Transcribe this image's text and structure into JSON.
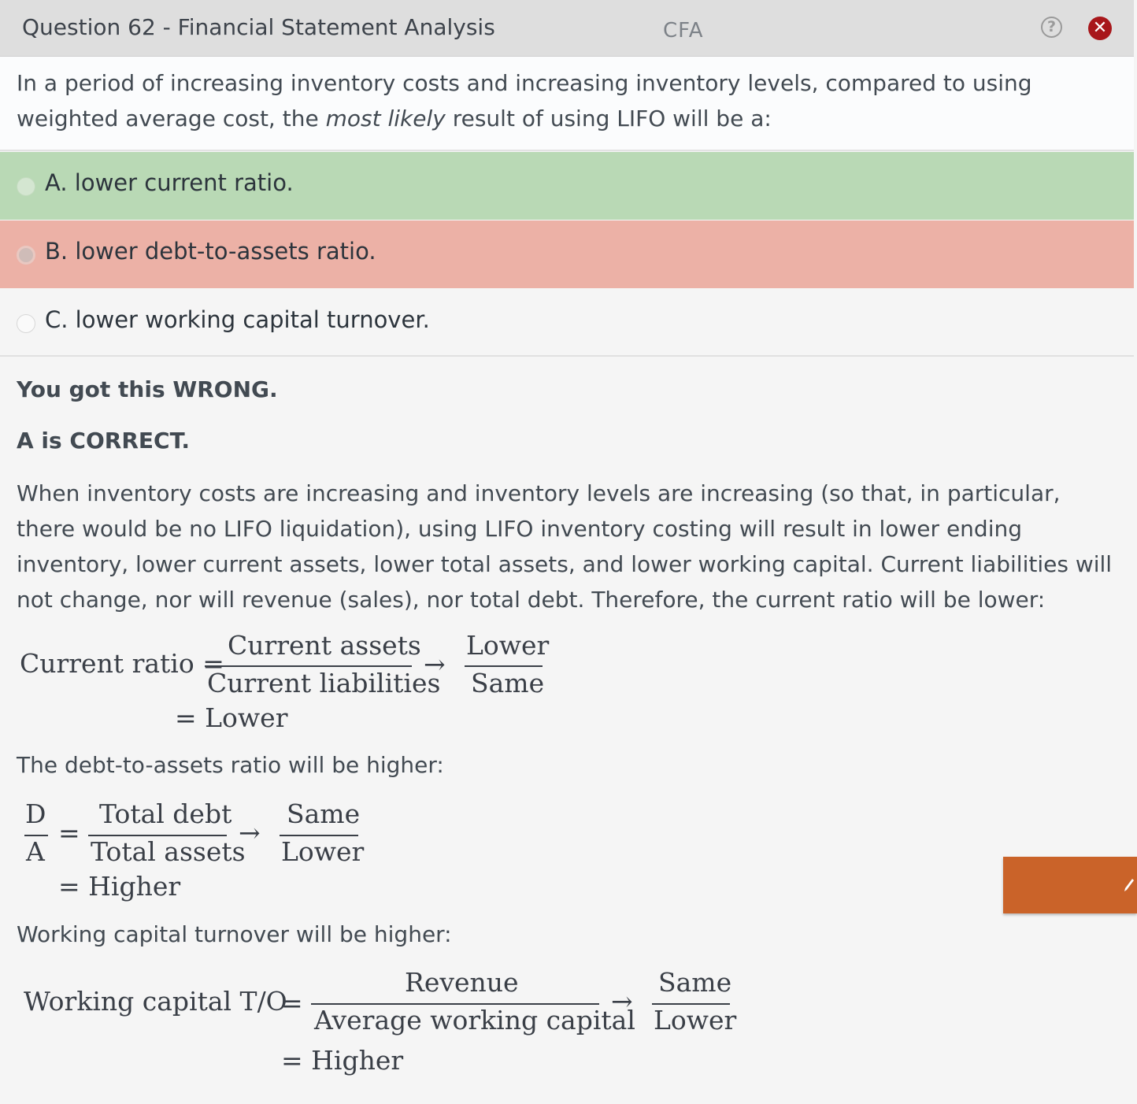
{
  "header": {
    "title": "Question 62 - Financial Statement Analysis",
    "tag": "CFA",
    "help_glyph": "?",
    "close_glyph": "✕"
  },
  "question": {
    "text_before": "In a period of increasing inventory costs and increasing inventory levels, compared to using weighted average cost, the ",
    "emphasis": "most likely",
    "text_after": " result of using LIFO will be a:"
  },
  "options": [
    {
      "label": "A. lower current ratio.",
      "state": "correct"
    },
    {
      "label": "B. lower debt-to-assets ratio.",
      "state": "selected-wrong"
    },
    {
      "label": "C. lower working capital turnover.",
      "state": "unselected"
    }
  ],
  "explanation": {
    "result": "You got this WRONG.",
    "correct": "A is CORRECT.",
    "paragraph": "When inventory costs are increasing and inventory levels are increasing (so that, in particular, there would be no LIFO liquidation), using LIFO inventory costing will result in lower ending inventory, lower current assets, lower total assets, and lower working capital.  Current liabilities will not change, nor will revenue (sales), nor total debt.  Therefore, the current ratio will be lower:",
    "debt_intro": "The debt-to-assets ratio will be higher:",
    "wc_intro": "Working capital turnover will be higher:"
  },
  "formulas": {
    "current": {
      "lhs": "Current ratio =",
      "num": "Current assets",
      "den": "Current liabilities",
      "arrow": "→",
      "num2": "Lower",
      "den2": "Same",
      "result": "= Lower"
    },
    "debt": {
      "lhs_num": "D",
      "lhs_den": "A",
      "eq": "=",
      "num": "Total debt",
      "den": "Total assets",
      "arrow": "→",
      "num2": "Same",
      "den2": "Lower",
      "result": "= Higher"
    },
    "wc": {
      "lhs": "Working capital T/O",
      "eq": "=",
      "num": "Revenue",
      "den": "Average working capital",
      "arrow": "→",
      "num2": "Same",
      "den2": "Lower",
      "result": "= Higher"
    }
  },
  "colors": {
    "correct_bg": "#b9d9b5",
    "wrong_bg": "#ecb1a6",
    "tab": "#ca6329",
    "close": "#a8171b"
  }
}
